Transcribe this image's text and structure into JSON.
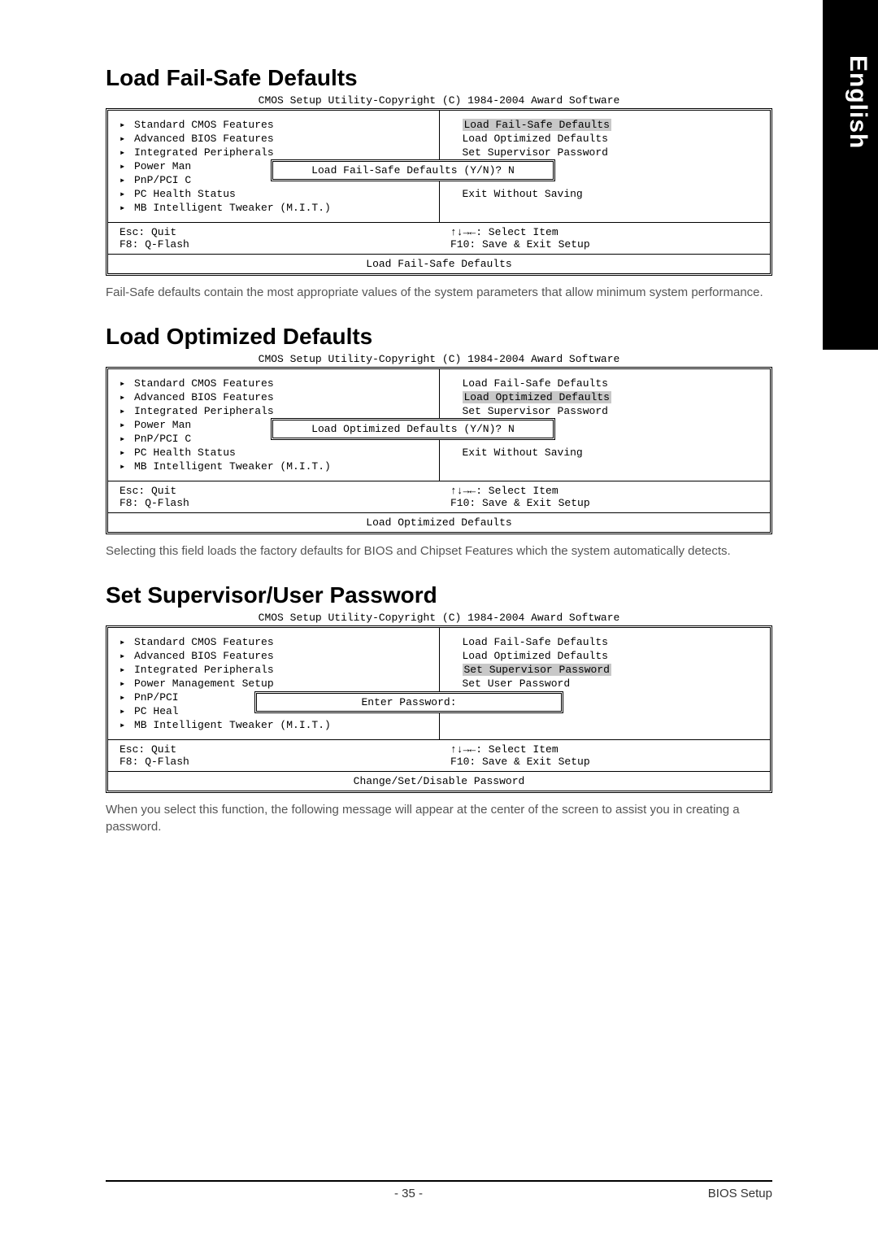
{
  "lang_tab": "English",
  "bios_header": "CMOS Setup Utility-Copyright (C) 1984-2004 Award Software",
  "left_menu": {
    "i0": "Standard CMOS Features",
    "i1": "Advanced BIOS Features",
    "i2": "Integrated Peripherals",
    "i3_full": "Power Management Setup",
    "i3_trunc_a": "Power Man",
    "i4_full": "PnP/PCI Configurations",
    "i4_trunc_a": "PnP/PCI C",
    "i4_trunc_b": "PnP/PCI",
    "i5": "PC Health Status",
    "i5_trunc": "PC Heal",
    "i6": "MB Intelligent Tweaker (M.I.T.)"
  },
  "right_menu": {
    "r0": "Load Fail-Safe Defaults",
    "r1": "Load Optimized Defaults",
    "r2": "Set Supervisor Password",
    "r3": "Set User Password",
    "r4_blank": "",
    "r5": "Exit Without Saving"
  },
  "footer_keys": {
    "esc": "Esc: Quit",
    "arrows": "↑↓→←: Select Item",
    "f8": "F8: Q-Flash",
    "f10": "F10: Save & Exit Setup"
  },
  "sections": {
    "s1": {
      "title": "Load Fail-Safe Defaults",
      "dialog": "Load Fail-Safe Defaults (Y/N)? N",
      "footer_desc": "Load Fail-Safe Defaults",
      "body": "Fail-Safe defaults contain the most appropriate values of the system parameters that allow minimum system performance."
    },
    "s2": {
      "title": "Load Optimized Defaults",
      "dialog": "Load Optimized Defaults (Y/N)? N",
      "footer_desc": "Load Optimized Defaults",
      "body": "Selecting this field loads the factory defaults for BIOS and Chipset Features which the system automatically detects."
    },
    "s3": {
      "title": "Set Supervisor/User Password",
      "dialog": "Enter Password:",
      "footer_desc": "Change/Set/Disable Password",
      "body": "When you select this function, the following message will appear at the center of the screen to assist you in creating a password."
    }
  },
  "page_footer": {
    "page_num": "- 35 -",
    "section_name": "BIOS Setup"
  }
}
